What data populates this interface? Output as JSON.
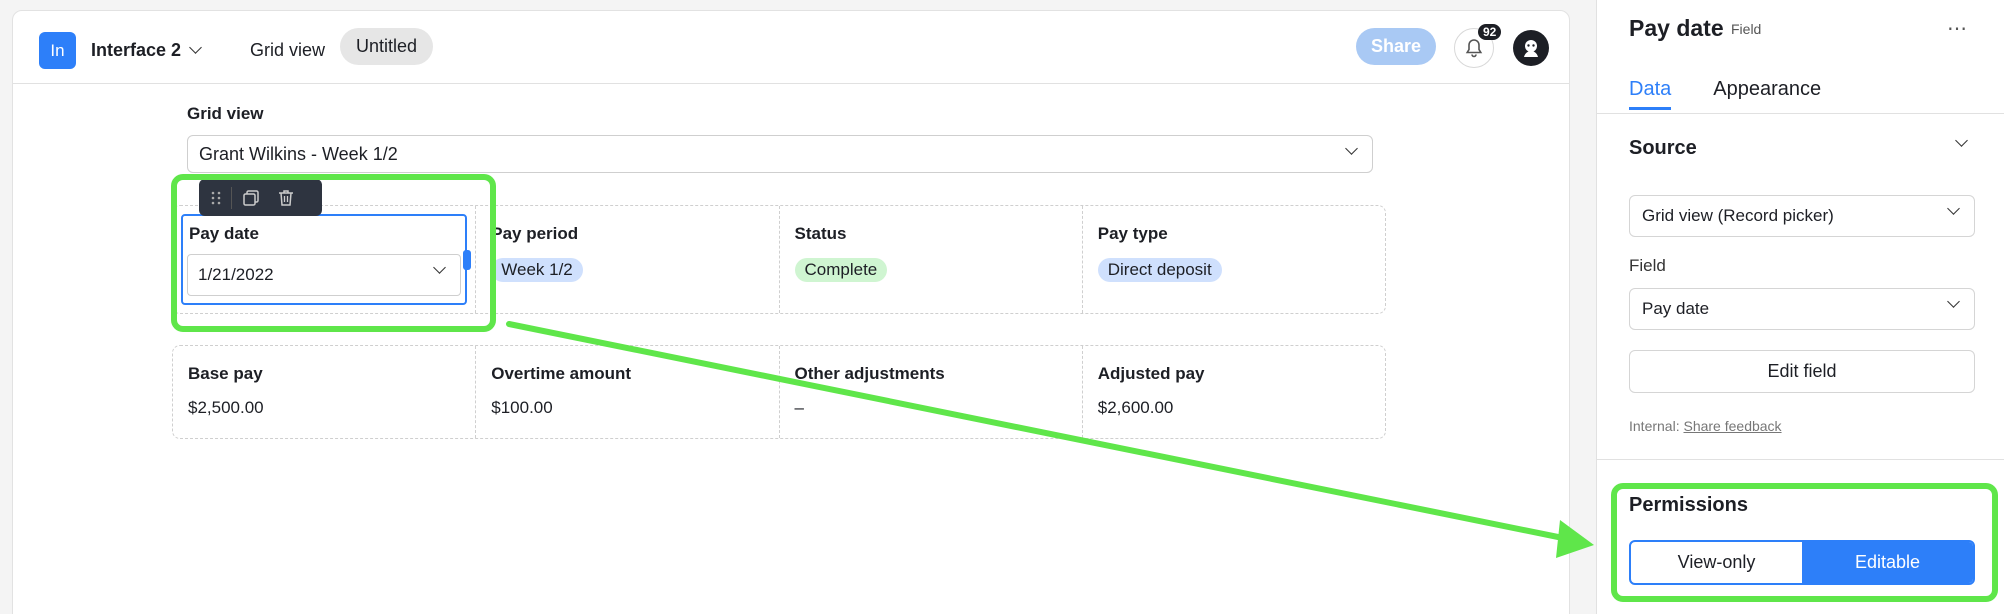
{
  "header": {
    "app_badge": "In",
    "interface_name": "Interface 2",
    "tabs": [
      "Grid view",
      "Untitled"
    ],
    "share_label": "Share",
    "notification_count": "92"
  },
  "main": {
    "grid_view_label": "Grid view",
    "record_selected": "Grant Wilkins - Week 1/2",
    "row1": [
      {
        "title": "Pay date",
        "value": "1/21/2022"
      },
      {
        "title": "Pay period",
        "value": "Week 1/2"
      },
      {
        "title": "Status",
        "value": "Complete"
      },
      {
        "title": "Pay type",
        "value": "Direct deposit"
      }
    ],
    "row2": [
      {
        "title": "Base pay",
        "value": "$2,500.00"
      },
      {
        "title": "Overtime amount",
        "value": "$100.00"
      },
      {
        "title": "Other adjustments",
        "value": "–"
      },
      {
        "title": "Adjusted pay",
        "value": "$2,600.00"
      }
    ]
  },
  "side_panel": {
    "title": "Pay date",
    "subtitle": "Field",
    "tabs": [
      "Data",
      "Appearance"
    ],
    "active_tab": "Data",
    "source_label": "Source",
    "source_value": "Grid view (Record picker)",
    "field_label": "Field",
    "field_value": "Pay date",
    "edit_field_label": "Edit field",
    "internal_prefix": "Internal:",
    "internal_link": "Share feedback",
    "permissions_label": "Permissions",
    "permission_options": [
      "View-only",
      "Editable"
    ],
    "permission_selected": "Editable"
  },
  "colors": {
    "accent": "#2d7ff9",
    "highlight_green": "#5fe64a",
    "pill_blue": "#cfe0fd",
    "pill_green": "#cff5d1"
  }
}
